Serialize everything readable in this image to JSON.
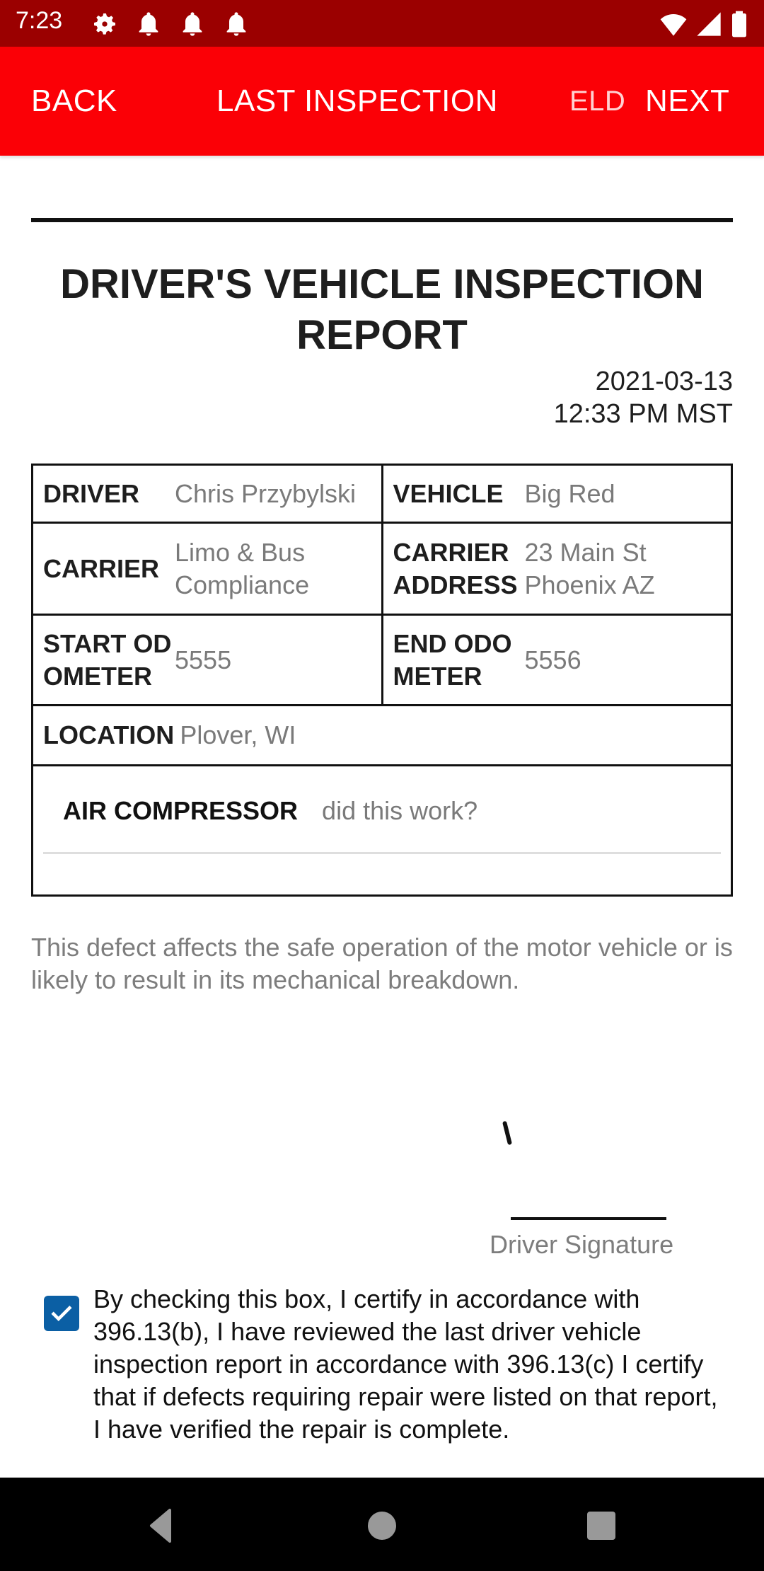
{
  "status_bar": {
    "time": "7:23",
    "left_icons": [
      "gear-icon",
      "bell-icon",
      "bell-icon",
      "bell-icon"
    ],
    "right_icons": [
      "wifi-icon",
      "signal-icon",
      "battery-icon"
    ]
  },
  "app_bar": {
    "back_label": "BACK",
    "title": "LAST INSPECTION",
    "eld_label": "ELD",
    "next_label": "NEXT",
    "color": "#fb0006",
    "status_color": "#9b0000"
  },
  "report": {
    "title": "DRIVER'S VEHICLE INSPECTION REPORT",
    "date": "2021-03-13",
    "time": "12:33 PM MST",
    "fields": {
      "driver": {
        "label": "DRIVER",
        "value": "Chris Przybylski"
      },
      "vehicle": {
        "label": "VEHICLE",
        "value": "Big Red"
      },
      "carrier": {
        "label": "CARRIER",
        "value": "Limo & Bus Compliance"
      },
      "carrier_address": {
        "label": "CARRIER ADDRESS",
        "value": "23 Main St Phoenix AZ"
      },
      "start_odometer": {
        "label": "START ODOMETER",
        "value": "5555"
      },
      "end_odometer": {
        "label": "END ODOMETER",
        "value": "5556"
      },
      "location": {
        "label": "LOCATION",
        "value": "Plover, WI"
      }
    },
    "defects": [
      {
        "name": "AIR COMPRESSOR",
        "note": "did this work?"
      }
    ],
    "defect_statement": "This defect affects the safe operation of the motor vehicle or is likely to result in its mechanical breakdown."
  },
  "signature": {
    "label": "Driver Signature"
  },
  "certify": {
    "checked": true,
    "text": "By checking this box, I certify in accordance with 396.13(b), I have reviewed the last driver vehicle inspection report in accordance with 396.13(c) I certify that if defects requiring repair were listed on that report, I have verified the repair is complete.",
    "checkbox_color": "#0b5fa4"
  },
  "nav_bar": {
    "buttons": [
      "back-nav",
      "home-nav",
      "recents-nav"
    ]
  }
}
